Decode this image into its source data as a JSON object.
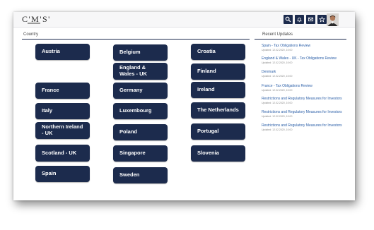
{
  "header": {
    "logo": "C'M'S'",
    "icons": [
      "search-icon",
      "bell-icon",
      "mail-icon",
      "star-icon"
    ]
  },
  "countries_section": {
    "label": "Country"
  },
  "updates_section": {
    "label": "Recent Updates"
  },
  "countries": [
    "Austria",
    "Belgium",
    "Croatia",
    "England & Wales - UK",
    "Finland",
    "France",
    "Germany",
    "Ireland",
    "Italy",
    "Luxembourg",
    "The Netherlands",
    "Northern Ireland - UK",
    "Poland",
    "Portugal",
    "Scotland - UK",
    "Singapore",
    "Slovenia",
    "Spain",
    "Sweden"
  ],
  "updates": [
    {
      "title": "Spain - Tax Obligations Review",
      "meta": "Updated: 12.02.2020, 10:00"
    },
    {
      "title": "England & Wales - UK - Tax Obligations Review",
      "meta": "Updated: 12.02.2020, 10:00"
    },
    {
      "title": "Denmark",
      "meta": "Updated: 12.02.2020, 10:00"
    },
    {
      "title": "France - Tax Obligations Review",
      "meta": "Updated: 12.02.2020, 10:00"
    },
    {
      "title": "Restrictions and Regulatory Measures for Investors",
      "meta": "Updated: 12.02.2020, 10:00"
    },
    {
      "title": "Restrictions and Regulatory Measures for Investors",
      "meta": "Updated: 12.02.2020, 10:00"
    },
    {
      "title": "Restrictions and Regulatory Measures for Investors",
      "meta": "Updated: 12.02.2020, 10:00"
    }
  ]
}
